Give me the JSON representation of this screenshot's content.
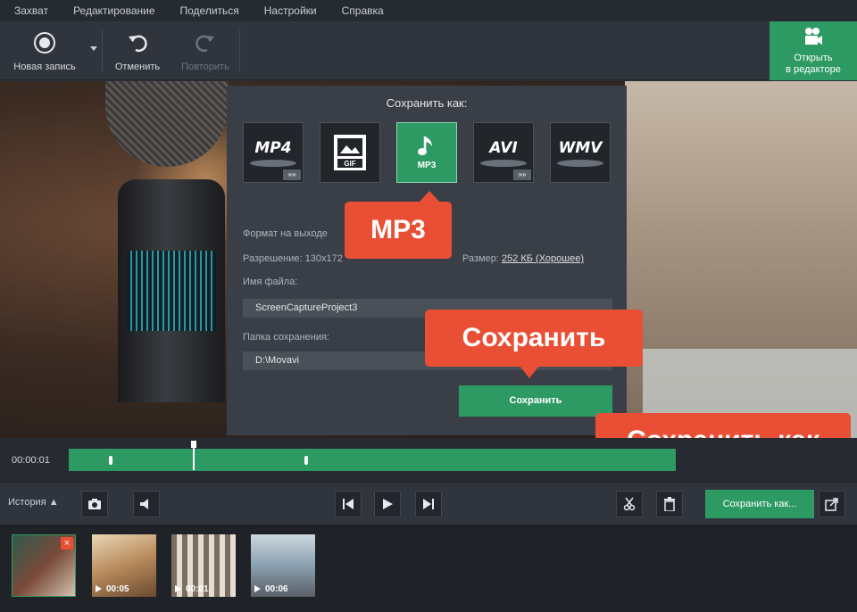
{
  "menu": [
    "Захват",
    "Редактирование",
    "Поделиться",
    "Настройки",
    "Справка"
  ],
  "toolbar": {
    "new_record": "Новая запись",
    "undo": "Отменить",
    "redo": "Повторить",
    "open_editor_line1": "Открыть",
    "open_editor_line2": "в редакторе"
  },
  "dialog": {
    "title": "Сохранить как:",
    "formats": [
      {
        "label": "MP4",
        "selected": false
      },
      {
        "label": "GIF",
        "selected": false
      },
      {
        "label": "MP3",
        "selected": true
      },
      {
        "label": "AVI",
        "selected": false
      },
      {
        "label": "WMV",
        "selected": false
      }
    ],
    "output_format_label": "Формат на выходе",
    "resolution_label": "Разрешение:",
    "resolution_value": "130x172",
    "size_label": "Размер:",
    "size_value": "252 КБ (Хорошее)",
    "filename_label": "Имя файла:",
    "filename_value": "ScreenCaptureProject3",
    "folder_label": "Папка сохранения:",
    "folder_value": "D:\\Movavi",
    "save_button": "Сохранить"
  },
  "callouts": {
    "mp3": "MP3",
    "save": "Сохранить",
    "save_as": "Сохранить как"
  },
  "timeline": {
    "time": "00:00:01"
  },
  "controls": {
    "history": "История",
    "save_as_button": "Сохранить как..."
  },
  "thumbnails": [
    {
      "duration": ""
    },
    {
      "duration": "00:05"
    },
    {
      "duration": "00:01"
    },
    {
      "duration": "00:06"
    }
  ],
  "colors": {
    "accent": "#2e9a63",
    "callout": "#e94f34"
  }
}
